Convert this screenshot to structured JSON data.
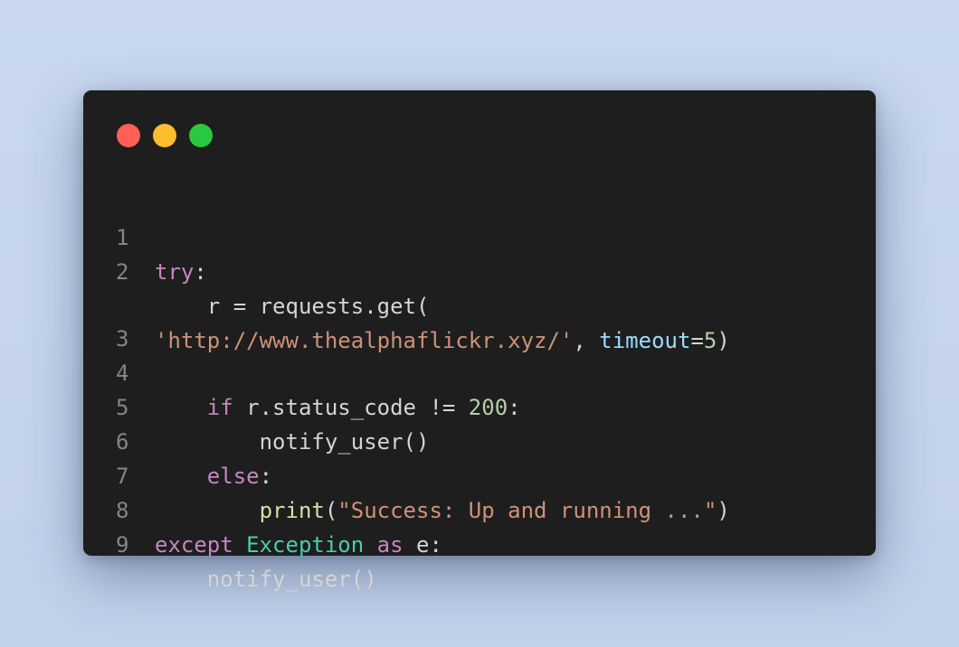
{
  "window": {
    "controls": {
      "close_color": "#ff5f56",
      "minimize_color": "#ffbd2e",
      "maximize_color": "#27c93f"
    }
  },
  "code": {
    "lines": [
      {
        "number": "1",
        "tokens": [
          "try",
          ":"
        ]
      },
      {
        "number": "2",
        "tokens": [
          "    r = requests.get("
        ]
      },
      {
        "number": "",
        "tokens": [
          "'http://www.thealphaflickr.xyz/'",
          ", ",
          "timeout",
          "=",
          "5",
          ")"
        ]
      },
      {
        "number": "3",
        "tokens": []
      },
      {
        "number": "4",
        "tokens": [
          "    ",
          "if",
          " r.status_code != ",
          "200",
          ":"
        ]
      },
      {
        "number": "5",
        "tokens": [
          "        notify_user()"
        ]
      },
      {
        "number": "6",
        "tokens": [
          "    ",
          "else",
          ":"
        ]
      },
      {
        "number": "7",
        "tokens": [
          "        ",
          "print",
          "(",
          "\"Success: Up and running ...\"",
          ")"
        ]
      },
      {
        "number": "8",
        "tokens": [
          "except",
          " ",
          "Exception",
          " ",
          "as",
          " e:"
        ]
      },
      {
        "number": "9",
        "tokens": [
          "    notify_user()"
        ]
      }
    ]
  }
}
